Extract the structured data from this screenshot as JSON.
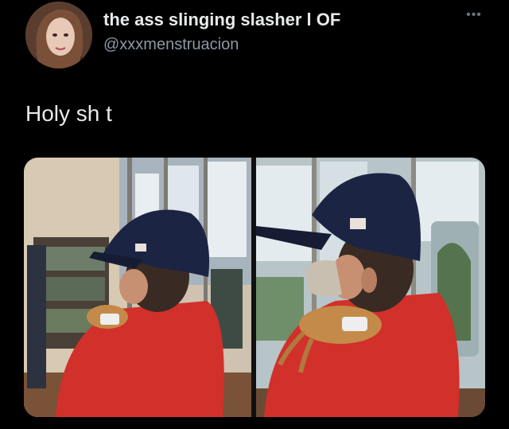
{
  "tweet": {
    "display_name": "the ass slinging slasher l OF",
    "handle": "@xxxmenstruacion",
    "more_icon": "more-horizontal-icon",
    "text": "Holy sh t"
  },
  "media": {
    "photo_count": 2
  },
  "colors": {
    "background": "#000000",
    "text_primary": "#e7e9ea",
    "text_secondary": "#8b98a5",
    "shirt": "#d2302a",
    "cap": "#1c2444"
  }
}
